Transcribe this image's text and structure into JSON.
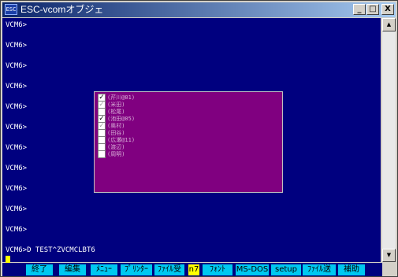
{
  "window": {
    "title": "ESC-vcomオブジェ",
    "icon_text": "ESC"
  },
  "title_buttons": {
    "minimize": "_",
    "maximize": "□",
    "close": "X"
  },
  "terminal": {
    "lines": [
      "VCM6>",
      "VCM6>",
      "VCM6>",
      "VCM6>",
      "VCM6>",
      "VCM6>",
      "VCM6>",
      "VCM6>",
      "VCM6>",
      "VCM6>",
      "VCM6>"
    ],
    "command_line": "VCM6>D TEST^ZVCMCLBT6",
    "background": "#00007f",
    "text_color": "#ffffff"
  },
  "popup": {
    "background": "#800080",
    "items": [
      {
        "label": "(芹川@01)",
        "state": "checked"
      },
      {
        "label": "(米田)",
        "state": "gray"
      },
      {
        "label": "(松尾)",
        "state": "unchecked"
      },
      {
        "label": "(池田@05)",
        "state": "checked"
      },
      {
        "label": "(奥村)",
        "state": "gray"
      },
      {
        "label": "(田谷)",
        "state": "unchecked"
      },
      {
        "label": "(広瀬@11)",
        "state": "unchecked"
      },
      {
        "label": "(渡辺)",
        "state": "unchecked"
      },
      {
        "label": "(周明)",
        "state": "unchecked"
      }
    ]
  },
  "function_keys": [
    {
      "label": "終了",
      "highlight": false
    },
    {
      "label": "編集",
      "highlight": false
    },
    {
      "label": "ﾒﾆｭｰ",
      "highlight": false
    },
    {
      "label": "ﾌﾟﾘﾝﾀｰ",
      "highlight": false
    },
    {
      "label": "ﾌｧｲﾙ受",
      "highlight": false
    },
    {
      "label": "n7",
      "highlight": true
    },
    {
      "label": "ﾌｫﾝﾄ",
      "highlight": false
    },
    {
      "label": "MS-DOS",
      "highlight": false
    },
    {
      "label": "setup",
      "highlight": false
    },
    {
      "label": "ﾌｧｲﾙ送",
      "highlight": false
    },
    {
      "label": "補助",
      "highlight": false
    }
  ],
  "scrollbar": {
    "up_arrow": "▲",
    "down_arrow": "▼"
  }
}
